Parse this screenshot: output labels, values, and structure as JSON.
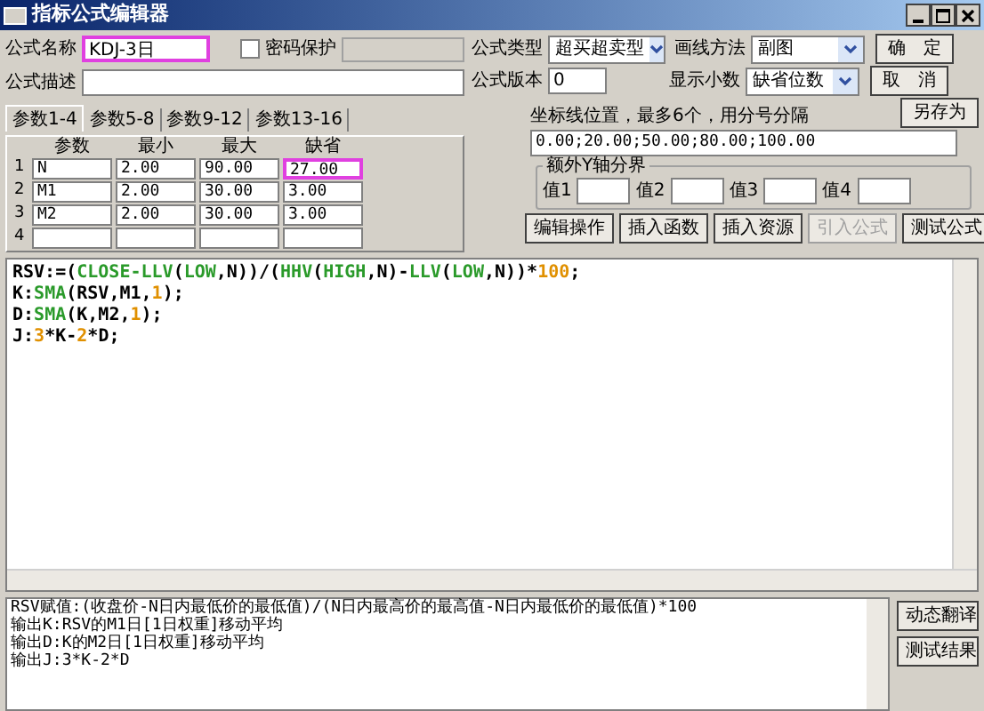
{
  "window": {
    "title": "指标公式编辑器"
  },
  "formula_name": {
    "label": "公式名称",
    "value": "KDJ-3日",
    "highlighted": true
  },
  "password": {
    "label": "密码保护",
    "checked": false
  },
  "formula_desc": {
    "label": "公式描述"
  },
  "formula_type": {
    "label": "公式类型",
    "value": "超买超卖型"
  },
  "draw_method": {
    "label": "画线方法",
    "value": "副图"
  },
  "formula_version": {
    "label": "公式版本",
    "value": "0"
  },
  "decimals": {
    "label": "显示小数",
    "value": "缺省位数"
  },
  "dialog_buttons": [
    "确　定",
    "取　消",
    "另存为"
  ],
  "tabs": [
    {
      "label": "参数1-4",
      "selected": true
    },
    {
      "label": "参数5-8",
      "selected": false
    },
    {
      "label": "参数9-12",
      "selected": false
    },
    {
      "label": "参数13-16",
      "selected": false
    }
  ],
  "params": {
    "columns": [
      "参数",
      "最小",
      "最大",
      "缺省"
    ],
    "rows": [
      {
        "index": "1",
        "cells": [
          "N",
          "2.00",
          "90.00",
          "27.00"
        ],
        "default_highlighted": true
      },
      {
        "index": "2",
        "cells": [
          "M1",
          "2.00",
          "30.00",
          "3.00"
        ],
        "default_highlighted": false
      },
      {
        "index": "3",
        "cells": [
          "M2",
          "2.00",
          "30.00",
          "3.00"
        ],
        "default_highlighted": false
      },
      {
        "index": "4",
        "cells": [],
        "default_highlighted": false
      }
    ]
  },
  "axis_lines": {
    "label": "坐标线位置，最多6个，用分号分隔",
    "value": "0.00;20.00;50.00;80.00;100.00"
  },
  "y_axis_group": {
    "title": "额外Y轴分界",
    "fields": [
      "值1",
      "值2",
      "值3",
      "值4"
    ]
  },
  "tool_buttons": [
    {
      "label": "编辑操作",
      "disabled": false
    },
    {
      "label": "插入函数",
      "disabled": false
    },
    {
      "label": "插入资源",
      "disabled": false
    },
    {
      "label": "引入公式",
      "disabled": true
    },
    {
      "label": "测试公式",
      "disabled": false
    }
  ],
  "code_lines": [
    [
      {
        "kind": "plain",
        "text": "RSV:=("
      },
      {
        "kind": "func",
        "text": "CLOSE-LLV"
      },
      {
        "kind": "plain",
        "text": "("
      },
      {
        "kind": "func",
        "text": "LOW"
      },
      {
        "kind": "plain",
        "text": ",N))/("
      },
      {
        "kind": "func",
        "text": "HHV"
      },
      {
        "kind": "plain",
        "text": "("
      },
      {
        "kind": "func",
        "text": "HIGH"
      },
      {
        "kind": "plain",
        "text": ",N)-"
      },
      {
        "kind": "func",
        "text": "LLV"
      },
      {
        "kind": "plain",
        "text": "("
      },
      {
        "kind": "func",
        "text": "LOW"
      },
      {
        "kind": "plain",
        "text": ",N))*"
      },
      {
        "kind": "num",
        "text": "100"
      },
      {
        "kind": "plain",
        "text": ";"
      }
    ],
    [
      {
        "kind": "plain",
        "text": "K:"
      },
      {
        "kind": "func",
        "text": "SMA"
      },
      {
        "kind": "plain",
        "text": "(RSV,M1,"
      },
      {
        "kind": "num",
        "text": "1"
      },
      {
        "kind": "plain",
        "text": ");"
      }
    ],
    [
      {
        "kind": "plain",
        "text": "D:"
      },
      {
        "kind": "func",
        "text": "SMA"
      },
      {
        "kind": "plain",
        "text": "(K,M2,"
      },
      {
        "kind": "num",
        "text": "1"
      },
      {
        "kind": "plain",
        "text": ");"
      }
    ],
    [
      {
        "kind": "plain",
        "text": "J:"
      },
      {
        "kind": "num",
        "text": "3"
      },
      {
        "kind": "plain",
        "text": "*K-"
      },
      {
        "kind": "num",
        "text": "2"
      },
      {
        "kind": "plain",
        "text": "*D;"
      }
    ]
  ],
  "output_lines": [
    "RSV赋值:(收盘价-N日内最低价的最低值)/(N日内最高价的最高值-N日内最低价的最低值)*100",
    "输出K:RSV的M1日[1日权重]移动平均",
    "输出D:K的M2日[1日权重]移动平均",
    "输出J:3*K-2*D"
  ],
  "output_buttons": [
    "动态翻译",
    "测试结果"
  ]
}
